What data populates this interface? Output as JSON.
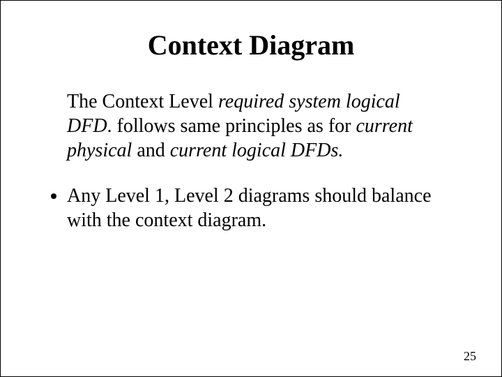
{
  "title": "Context Diagram",
  "para": {
    "t1": "The  Context Level ",
    "i1": "required system logical DFD",
    "t2": ". follows same principles as for ",
    "i2": "current physical",
    "t3": " and ",
    "i3": "current logical DFDs.",
    "t4": ""
  },
  "bullets": [
    "Any Level 1, Level 2 diagrams should balance with the context diagram."
  ],
  "pageNumber": "25"
}
